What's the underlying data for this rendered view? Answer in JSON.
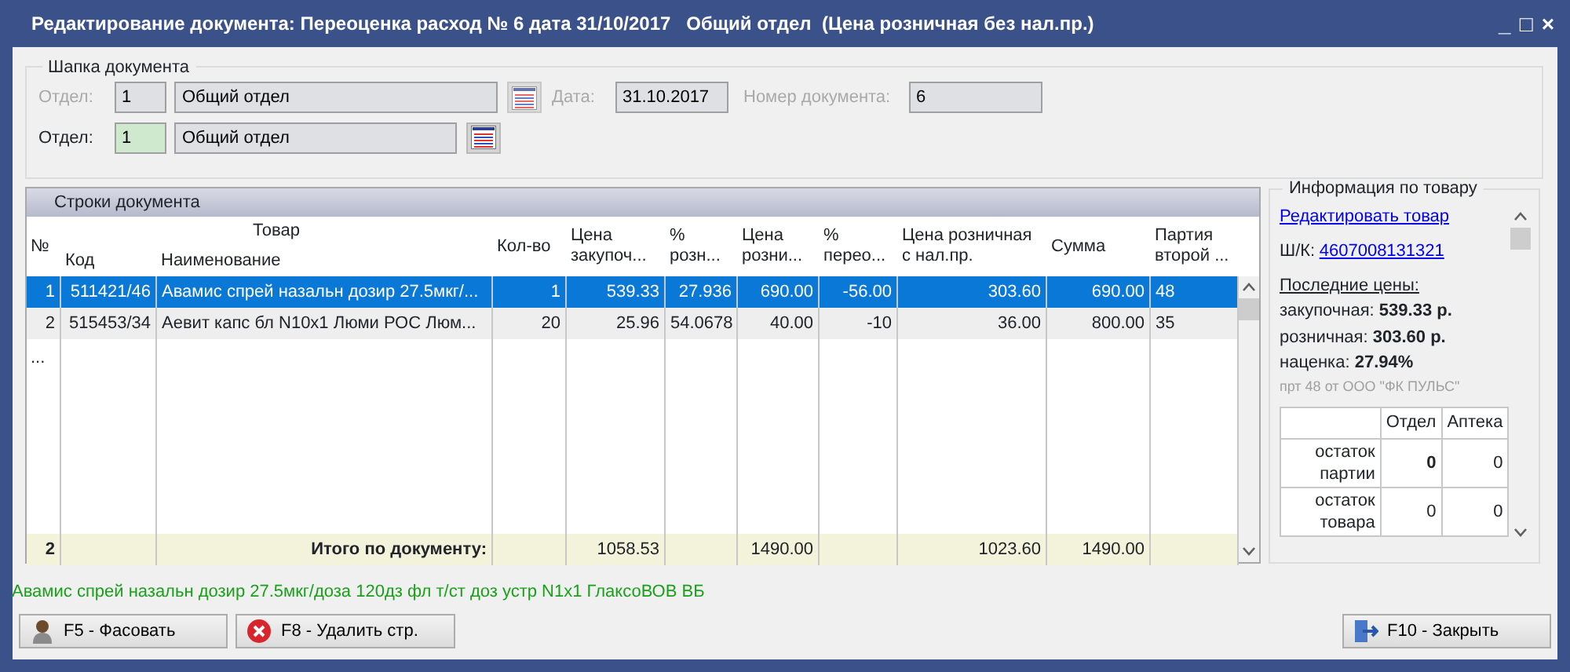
{
  "window": {
    "title": "Редактирование документа: Переоценка расход № 6 дата 31/10/2017   Общий отдел  (Цена розничная без нал.пр.)",
    "controls": [
      "_",
      "□",
      "×"
    ]
  },
  "header": {
    "title": "Шапка документа",
    "rows": [
      {
        "disabled": true,
        "dept_label": "Отдел:",
        "dept_code": "1",
        "dept_name": "Общий отдел",
        "date_label": "Дата:",
        "date": "31.10.2017",
        "number_label": "Номер документа:",
        "number": "6"
      },
      {
        "disabled": false,
        "dept_label": "Отдел:",
        "dept_code": "1",
        "dept_name": "Общий отдел"
      }
    ]
  },
  "grid": {
    "title": "Строки документа",
    "group_header": "Товар",
    "columns": [
      {
        "label": "№"
      },
      {
        "label": "Код"
      },
      {
        "label": "Наименование"
      },
      {
        "label": "Кол-во"
      },
      {
        "label": "Цена закупоч..."
      },
      {
        "label": "% розн..."
      },
      {
        "label": "Цена розни..."
      },
      {
        "label": "% перео..."
      },
      {
        "label": "Цена розничная с нал.пр."
      },
      {
        "label": "Сумма"
      },
      {
        "label": "Партия второй ..."
      }
    ],
    "rows": [
      {
        "selected": true,
        "cells": [
          "1",
          "511421/46",
          "Авамис спрей назальн дозир 27.5мкг/...",
          "1",
          "539.33",
          "27.936",
          "690.00",
          "-56.00",
          "303.60",
          "690.00",
          "48"
        ]
      },
      {
        "selected": false,
        "cells": [
          "2",
          "515453/34",
          "Аевит капс бл N10x1 Люми РОС Люм...",
          "20",
          "25.96",
          "54.0678",
          "40.00",
          "-10",
          "36.00",
          "800.00",
          "35"
        ]
      }
    ],
    "more": "...",
    "footer": {
      "count": "2",
      "label": "Итого по документу:",
      "cost": "1058.53",
      "retail": "1490.00",
      "retail_tax": "1023.60",
      "sum": "1490.00"
    }
  },
  "info": {
    "title": "Информация по товару",
    "edit_link": "Редактировать товар",
    "barcode_label": "Ш/К:",
    "barcode": "4607008131321",
    "prices_title": "Последние цены:",
    "prices": [
      "закупочная: **539.33 р.**",
      "розничная: **303.60 р.**",
      "наценка: **27.94%**"
    ],
    "note": "прт 48 от ООО \"ФК ПУЛЬС\"",
    "stock": {
      "columns": [
        "Отдел",
        "Аптека"
      ],
      "rows": [
        {
          "label": "остаток партии",
          "values": [
            {
              "text": "0",
              "bold": true
            },
            {
              "text": "0",
              "bold": false
            }
          ]
        },
        {
          "label": "остаток товара",
          "values": [
            {
              "text": "0",
              "bold": false
            },
            {
              "text": "0",
              "bold": false
            }
          ]
        }
      ]
    }
  },
  "status": "Авамис спрей назальн дозир 27.5мкг/доза 120дз фл т/ст доз устр N1x1 ГлаксоВОВ ВБ",
  "buttons": [
    {
      "kind": "pack",
      "label": "F5 - Фасовать"
    },
    {
      "kind": "delete",
      "label": "F8 - Удалить стр."
    },
    {
      "kind": "close",
      "label": "F10 - Закрыть"
    }
  ]
}
